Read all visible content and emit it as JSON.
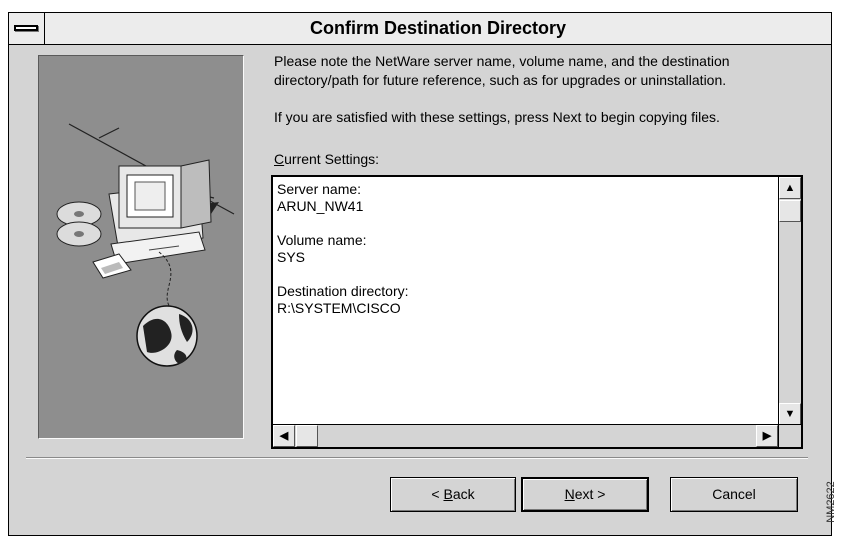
{
  "window": {
    "title": "Confirm Destination Directory"
  },
  "intro": {
    "line1": "Please note the NetWare server name, volume name, and the destination directory/path for future reference, such as for upgrades or uninstallation.",
    "line2": "If you are satisfied with these settings, press Next to begin copying files."
  },
  "settings": {
    "label_first": "C",
    "label_rest": "urrent Settings:",
    "groups": [
      {
        "label": "Server name:",
        "value": "ARUN_NW41"
      },
      {
        "label": "Volume name:",
        "value": "SYS"
      },
      {
        "label": "Destination directory:",
        "value": "R:\\SYSTEM\\CISCO"
      }
    ]
  },
  "scroll": {
    "up": "▲",
    "down": "▼",
    "left": "◀",
    "right": "▶"
  },
  "buttons": {
    "back_pre": "< ",
    "back_key": "B",
    "back_post": "ack",
    "next_key": "N",
    "next_post": "ext >",
    "cancel": "Cancel"
  },
  "stamp": "NM2622",
  "icons": [
    "system-menu-icon",
    "computer-illustration",
    "cd-icon",
    "floppy-icon",
    "globe-icon"
  ]
}
